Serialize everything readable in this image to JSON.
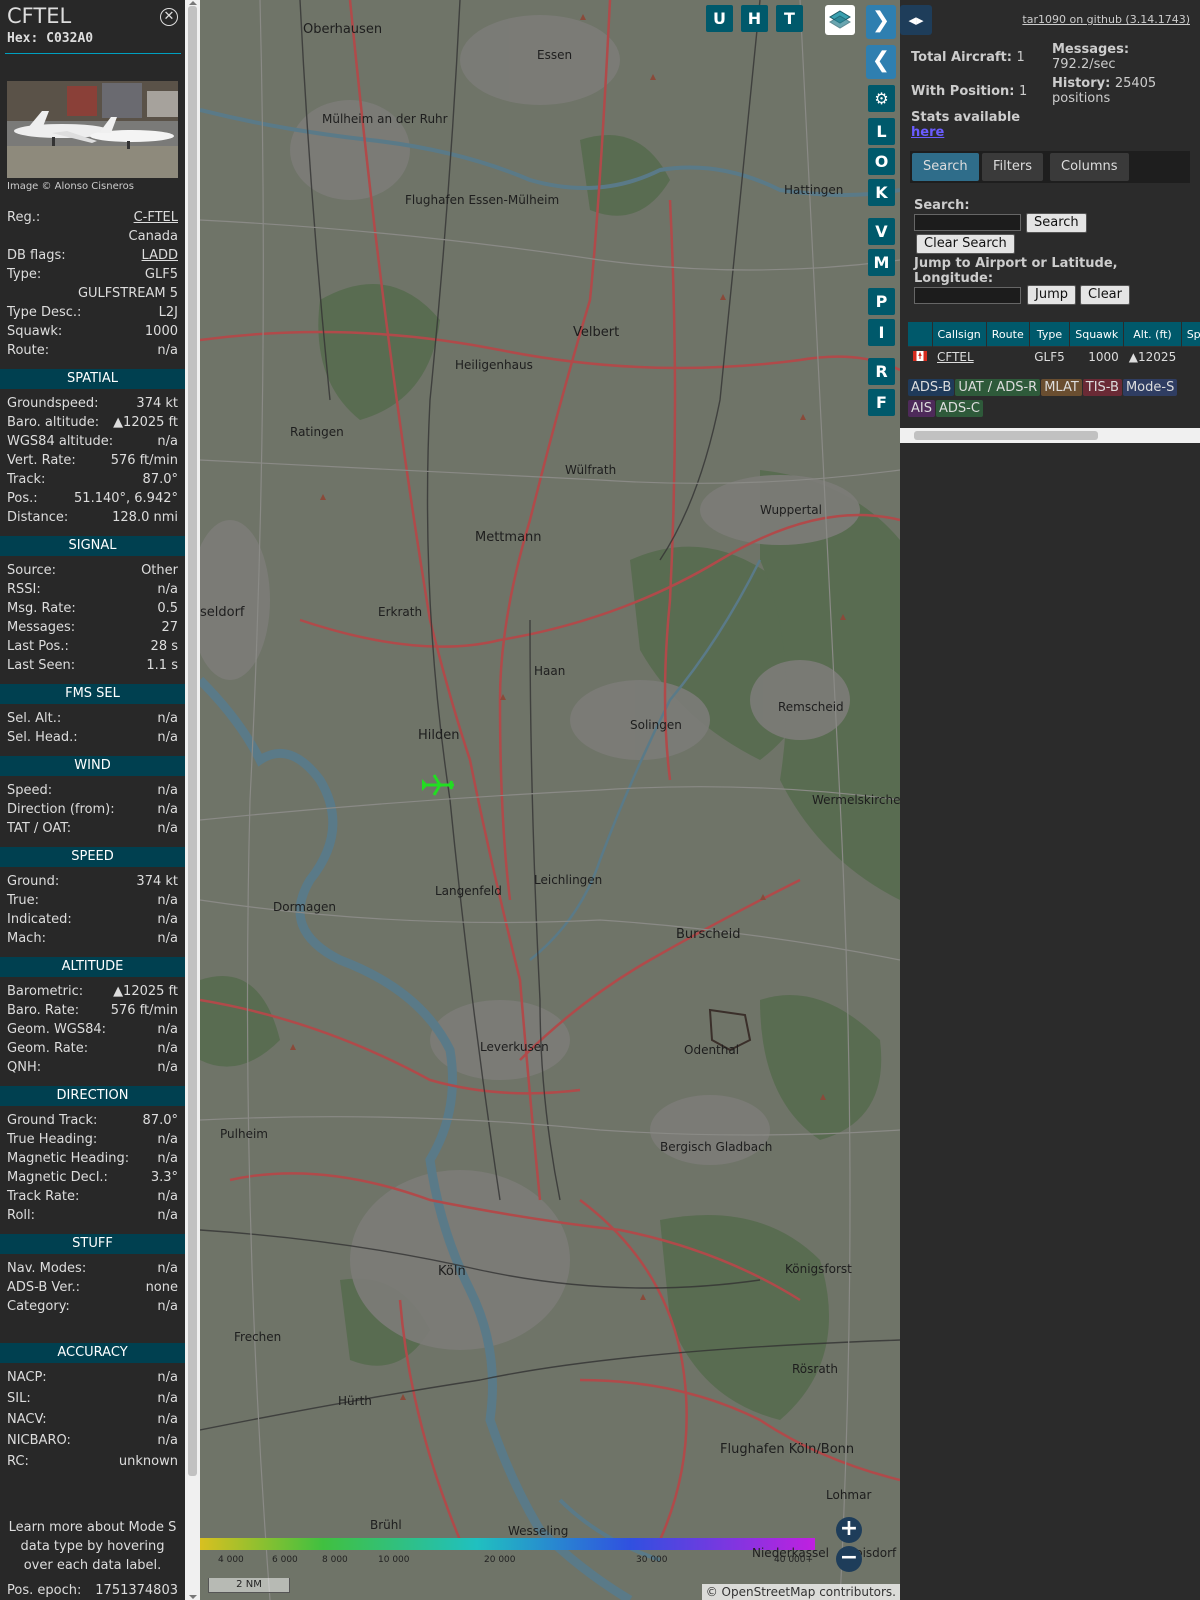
{
  "info": {
    "callsign": "CFTEL",
    "hex": "Hex: C032A0",
    "image_credit": "Image © Alonso Cisneros",
    "rows_top": [
      {
        "k": "Reg.:",
        "v": "C-FTEL",
        "link": true
      },
      {
        "k": "",
        "v": "Canada"
      },
      {
        "k": "DB flags:",
        "v": "LADD",
        "link": true
      },
      {
        "k": "Type:",
        "v": "GLF5"
      },
      {
        "k": "",
        "v": "GULFSTREAM 5"
      },
      {
        "k": "Type Desc.:",
        "v": "L2J"
      },
      {
        "k": "Squawk:",
        "v": "1000"
      },
      {
        "k": "Route:",
        "v": "n/a"
      }
    ],
    "sections": [
      {
        "title": "SPATIAL",
        "rows": [
          {
            "k": "Groundspeed:",
            "v": "374 kt"
          },
          {
            "k": "Baro. altitude:",
            "v": "▲12025 ft"
          },
          {
            "k": "WGS84 altitude:",
            "v": "n/a"
          },
          {
            "k": "Vert. Rate:",
            "v": "576 ft/min"
          },
          {
            "k": "Track:",
            "v": "87.0°"
          },
          {
            "k": "Pos.:",
            "v": "51.140°, 6.942°"
          },
          {
            "k": "Distance:",
            "v": "128.0 nmi"
          }
        ]
      },
      {
        "title": "SIGNAL",
        "rows": [
          {
            "k": "Source:",
            "v": "Other"
          },
          {
            "k": "RSSI:",
            "v": "n/a"
          },
          {
            "k": "Msg. Rate:",
            "v": "0.5"
          },
          {
            "k": "Messages:",
            "v": "27"
          },
          {
            "k": "Last Pos.:",
            "v": "28 s"
          },
          {
            "k": "Last Seen:",
            "v": "1.1 s"
          }
        ]
      },
      {
        "title": "FMS SEL",
        "rows": [
          {
            "k": "Sel. Alt.:",
            "v": "n/a"
          },
          {
            "k": "Sel. Head.:",
            "v": "n/a"
          }
        ]
      },
      {
        "title": "WIND",
        "rows": [
          {
            "k": "Speed:",
            "v": "n/a"
          },
          {
            "k": "Direction (from):",
            "v": "n/a"
          },
          {
            "k": "TAT / OAT:",
            "v": "n/a"
          }
        ]
      },
      {
        "title": "SPEED",
        "rows": [
          {
            "k": "Ground:",
            "v": "374 kt"
          },
          {
            "k": "True:",
            "v": "n/a"
          },
          {
            "k": "Indicated:",
            "v": "n/a"
          },
          {
            "k": "Mach:",
            "v": "n/a"
          }
        ]
      },
      {
        "title": "ALTITUDE",
        "rows": [
          {
            "k": "Barometric:",
            "v": "▲12025 ft"
          },
          {
            "k": "Baro. Rate:",
            "v": "576 ft/min"
          },
          {
            "k": "Geom. WGS84:",
            "v": "n/a"
          },
          {
            "k": "Geom. Rate:",
            "v": "n/a"
          },
          {
            "k": "QNH:",
            "v": "n/a"
          }
        ]
      },
      {
        "title": "DIRECTION",
        "rows": [
          {
            "k": "Ground Track:",
            "v": "87.0°"
          },
          {
            "k": "True Heading:",
            "v": "n/a"
          },
          {
            "k": "Magnetic Heading:",
            "v": "n/a"
          },
          {
            "k": "Magnetic Decl.:",
            "v": "3.3°"
          },
          {
            "k": "Track Rate:",
            "v": "n/a"
          },
          {
            "k": "Roll:",
            "v": "n/a"
          }
        ]
      },
      {
        "title": "STUFF",
        "rows": [
          {
            "k": "Nav. Modes:",
            "v": "n/a"
          },
          {
            "k": "ADS-B Ver.:",
            "v": "none"
          },
          {
            "k": "Category:",
            "v": "n/a"
          }
        ]
      },
      {
        "title": "ACCURACY",
        "rows": [
          {
            "k": "NACP:",
            "v": "n/a"
          },
          {
            "k": "SIL:",
            "v": "n/a"
          },
          {
            "k": "NACV:",
            "v": "n/a"
          },
          {
            "k": "NICBARO:",
            "v": "n/a"
          },
          {
            "k": "RC:",
            "v": "unknown"
          }
        ]
      }
    ],
    "note": "Learn more about Mode S data type by hovering over each data label.",
    "epoch_label": "Pos. epoch:",
    "epoch_value": "1751374803"
  },
  "map": {
    "buttons_top": [
      "U",
      "H",
      "T"
    ],
    "buttons_side": [
      "L",
      "O",
      "K",
      "V",
      "M",
      "P",
      "I",
      "R",
      "F"
    ],
    "places": [
      {
        "name": "Oberhausen"
      },
      {
        "name": "Essen"
      },
      {
        "name": "Mülheim an der Ruhr"
      },
      {
        "name": "Hattingen"
      },
      {
        "name": "Flughafen Essen-Mülheim"
      },
      {
        "name": "Velbert"
      },
      {
        "name": "Heiligenhaus"
      },
      {
        "name": "Ratingen"
      },
      {
        "name": "Wülfrath"
      },
      {
        "name": "Wuppertal"
      },
      {
        "name": "Mettmann"
      },
      {
        "name": "Erkrath"
      },
      {
        "name": "Haan"
      },
      {
        "name": "Solingen"
      },
      {
        "name": "Remscheid"
      },
      {
        "name": "Hilden"
      },
      {
        "name": "Wermelskirchen"
      },
      {
        "name": "Leichlingen"
      },
      {
        "name": "Langenfeld"
      },
      {
        "name": "Dormagen"
      },
      {
        "name": "Burscheid"
      },
      {
        "name": "Leverkusen"
      },
      {
        "name": "Odenthal"
      },
      {
        "name": "Pulheim"
      },
      {
        "name": "Bergisch Gladbach"
      },
      {
        "name": "Köln"
      },
      {
        "name": "Königsforst"
      },
      {
        "name": "Frechen"
      },
      {
        "name": "Rösrath"
      },
      {
        "name": "Hürth"
      },
      {
        "name": "Flughafen Köln/Bonn"
      },
      {
        "name": "Lohmar"
      },
      {
        "name": "Brühl"
      },
      {
        "name": "Wesseling"
      },
      {
        "name": "Niederkassel"
      },
      {
        "name": "seldorf"
      },
      {
        "name": "Troisdorf"
      }
    ],
    "scale": "2 NM",
    "alt_legend": [
      "4 000",
      "6 000",
      "8 000",
      "10 000",
      "20 000",
      "30 000",
      "40 000+"
    ],
    "attribution": "© OpenStreetMap contributors."
  },
  "right": {
    "github": "tar1090 on github (3.14.1743)",
    "total_aircraft_label": "Total Aircraft:",
    "total_aircraft": "1",
    "with_position_label": "With Position:",
    "with_position": "1",
    "stats_label": "Stats available",
    "stats_link": "here",
    "messages_label": "Messages:",
    "messages": "792.2/sec",
    "history_label": "History:",
    "history": "25405 positions",
    "tabs": [
      "Search",
      "Filters",
      "Columns"
    ],
    "search_label": "Search:",
    "search_button": "Search",
    "clear_search_button": "Clear Search",
    "jump_label": "Jump to Airport or Latitude, Longitude:",
    "jump_button": "Jump",
    "clear_button": "Clear",
    "table_headers": [
      "",
      "Callsign",
      "Route",
      "Type",
      "Squawk",
      "Alt. (ft)",
      "Spd"
    ],
    "table_rows": [
      {
        "callsign": "CFTEL",
        "route": "",
        "type": "GLF5",
        "squawk": "1000",
        "alt": "▲12025",
        "spd": ""
      }
    ],
    "sources": [
      {
        "label": "ADS-B",
        "color": "#1f3a5a"
      },
      {
        "label": "UAT / ADS-R",
        "color": "#2e5a3a"
      },
      {
        "label": "MLAT",
        "color": "#6a4e30"
      },
      {
        "label": "TIS-B",
        "color": "#6a2a35"
      },
      {
        "label": "Mode-S",
        "color": "#2f3d62"
      },
      {
        "label": "AIS",
        "color": "#4e2a5a"
      },
      {
        "label": "ADS-C",
        "color": "#2e5a3a"
      }
    ]
  }
}
